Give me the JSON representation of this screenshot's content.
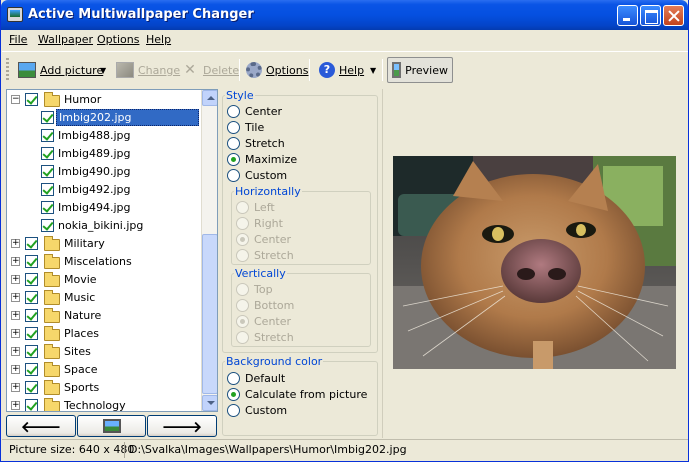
{
  "window": {
    "title": "Active Multiwallpaper Changer"
  },
  "menu": [
    {
      "label": "File",
      "underline": "F"
    },
    {
      "label": "Wallpaper",
      "underline": "W"
    },
    {
      "label": "Options",
      "underline": "O"
    },
    {
      "label": "Help",
      "underline": "H"
    }
  ],
  "toolbar": {
    "add_picture": "Add picture",
    "change": "Change",
    "delete": "Delete",
    "options": "Options",
    "help": "Help",
    "preview": "Preview"
  },
  "tree": {
    "open_folder": "Humor",
    "files": [
      "Imbig202.jpg",
      "Imbig488.jpg",
      "Imbig489.jpg",
      "Imbig490.jpg",
      "Imbig492.jpg",
      "Imbig494.jpg",
      "nokia_bikini.jpg"
    ],
    "selected_file": "Imbig202.jpg",
    "folders": [
      "Military",
      "Miscelations",
      "Movie",
      "Music",
      "Nature",
      "Places",
      "Sites",
      "Space",
      "Sports",
      "Technology"
    ]
  },
  "style": {
    "legend": "Style",
    "options": [
      "Center",
      "Tile",
      "Stretch",
      "Maximize",
      "Custom"
    ],
    "selected": "Maximize",
    "horizontally": {
      "legend": "Horizontally",
      "options": [
        "Left",
        "Right",
        "Center",
        "Stretch"
      ],
      "selected": "Center"
    },
    "vertically": {
      "legend": "Vertically",
      "options": [
        "Top",
        "Bottom",
        "Center",
        "Stretch"
      ],
      "selected": "Center"
    }
  },
  "background": {
    "legend": "Background color",
    "options": [
      "Default",
      "Calculate from picture",
      "Custom"
    ],
    "selected": "Calculate from picture"
  },
  "status": {
    "size": "Picture size: 640 x 480",
    "path": "D:\\Svalka\\Images\\Wallpapers\\Humor\\Imbig202.jpg"
  },
  "colors": {
    "title_bar": "#0550e0",
    "selection": "#316ac5",
    "legend": "#0046d5",
    "checkmark": "#21a121"
  }
}
